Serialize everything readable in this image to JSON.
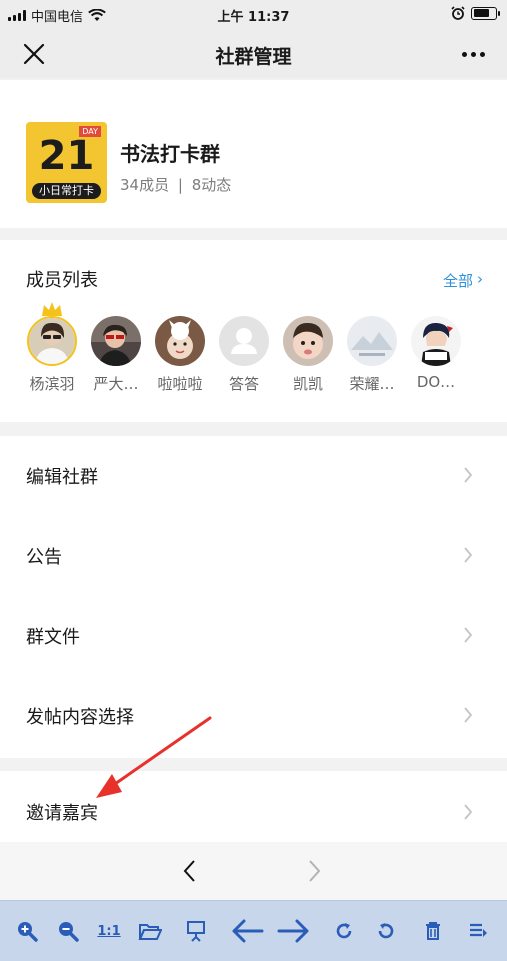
{
  "status_bar": {
    "carrier": "中国电信",
    "time": "上午 11:37"
  },
  "nav": {
    "title": "社群管理"
  },
  "group": {
    "logo": {
      "day": "DAY",
      "number": "21",
      "caption": "小日常打卡"
    },
    "name": "书法打卡群",
    "members_count": "34成员",
    "posts_count": "8动态"
  },
  "members": {
    "title": "成员列表",
    "all_label": "全部",
    "list": [
      {
        "name": "杨滨羽",
        "color": "#c9b79a"
      },
      {
        "name": "严大…",
        "color": "#6e5d58"
      },
      {
        "name": "啦啦啦",
        "color": "#8c6a52"
      },
      {
        "name": "答答",
        "color": "#dcdcdc"
      },
      {
        "name": "凯凯",
        "color": "#b9a79a"
      },
      {
        "name": "荣耀…",
        "color": "#d9dfe8"
      },
      {
        "name": "DO…",
        "color": "#f0f0f0"
      }
    ]
  },
  "menu": {
    "items": [
      {
        "label": "编辑社群"
      },
      {
        "label": "公告"
      },
      {
        "label": "群文件"
      },
      {
        "label": "发帖内容选择"
      }
    ],
    "invite_label": "邀请嘉宾"
  },
  "colors": {
    "accent": "#2f8fd8",
    "arrow": "#e8312a",
    "toolbar_icon": "#2a5db8"
  },
  "toolbar": {
    "one_to_one_label": "1:1"
  }
}
